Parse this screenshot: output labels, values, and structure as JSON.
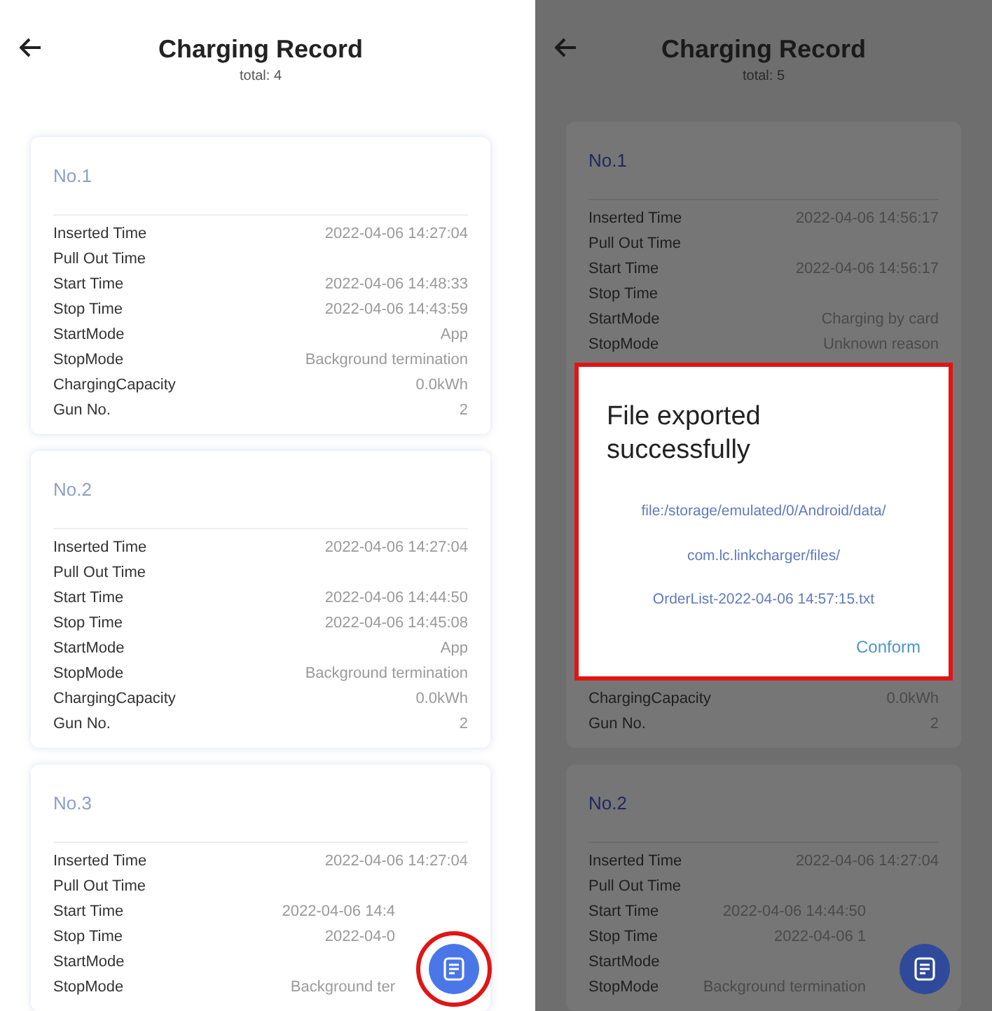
{
  "screens": [
    {
      "title": "Charging Record",
      "total": "total: 4",
      "dimmed": false,
      "records": [
        {
          "number": "No.1",
          "rows": [
            {
              "label": "Inserted Time",
              "value": "2022-04-06 14:27:04"
            },
            {
              "label": "Pull Out Time"
            },
            {
              "label": "Start Time",
              "value": "2022-04-06 14:48:33"
            },
            {
              "label": "Stop Time",
              "value": "2022-04-06 14:43:59"
            },
            {
              "label": "StartMode",
              "value": "App"
            },
            {
              "label": "StopMode",
              "value": "Background termination"
            },
            {
              "label": "ChargingCapacity",
              "value": "0.0kWh"
            },
            {
              "label": "Gun No.",
              "value": "2"
            }
          ]
        },
        {
          "number": "No.2",
          "rows": [
            {
              "label": "Inserted Time",
              "value": "2022-04-06 14:27:04"
            },
            {
              "label": "Pull Out Time"
            },
            {
              "label": "Start Time",
              "value": "2022-04-06 14:44:50"
            },
            {
              "label": "Stop Time",
              "value": "2022-04-06 14:45:08"
            },
            {
              "label": "StartMode",
              "value": "App"
            },
            {
              "label": "StopMode",
              "value": "Background termination"
            },
            {
              "label": "ChargingCapacity",
              "value": "0.0kWh"
            },
            {
              "label": "Gun No.",
              "value": "2"
            }
          ]
        },
        {
          "number": "No.3",
          "rows": [
            {
              "label": "Inserted Time",
              "value": "2022-04-06 14:27:04"
            },
            {
              "label": "Pull Out Time"
            },
            {
              "label": "Start Time",
              "value": "2022-04-06 14:4"
            },
            {
              "label": "Stop Time",
              "value": "2022-04-0"
            },
            {
              "label": "StartMode"
            },
            {
              "label": "StopMode",
              "value": "Background ter"
            }
          ]
        }
      ]
    },
    {
      "title": "Charging Record",
      "total": "total: 5",
      "dimmed": true,
      "records": [
        {
          "number": "No.1",
          "rows": [
            {
              "label": "Inserted Time",
              "value": "2022-04-06 14:56:17"
            },
            {
              "label": "Pull Out Time"
            },
            {
              "label": "Start Time",
              "value": "2022-04-06 14:56:17"
            },
            {
              "label": "Stop Time"
            },
            {
              "label": "StartMode",
              "value": "Charging by card"
            },
            {
              "label": "StopMode",
              "value": "Unknown reason"
            }
          ],
          "dialog": {
            "title": "File exported successfully",
            "path_lines": [
              "file:/storage/emulated/0/Android/data/",
              "com.lc.linkcharger/files/",
              "OrderList-2022-04-06 14:57:15.txt"
            ],
            "button": "Conform"
          },
          "rows_below": [
            {
              "label": "ChargingCapacity",
              "value": "0.0kWh"
            },
            {
              "label": "Gun No.",
              "value": "2"
            }
          ]
        },
        {
          "number": "No.2",
          "rows": [
            {
              "label": "Inserted Time",
              "value": "2022-04-06 14:27:04"
            },
            {
              "label": "Pull Out Time"
            },
            {
              "label": "Start Time",
              "value": "2022-04-06 14:44:50"
            },
            {
              "label": "Stop Time",
              "value": "2022-04-06 1"
            },
            {
              "label": "StartMode"
            },
            {
              "label": "StopMode",
              "value": "Background termination"
            }
          ]
        }
      ]
    }
  ]
}
